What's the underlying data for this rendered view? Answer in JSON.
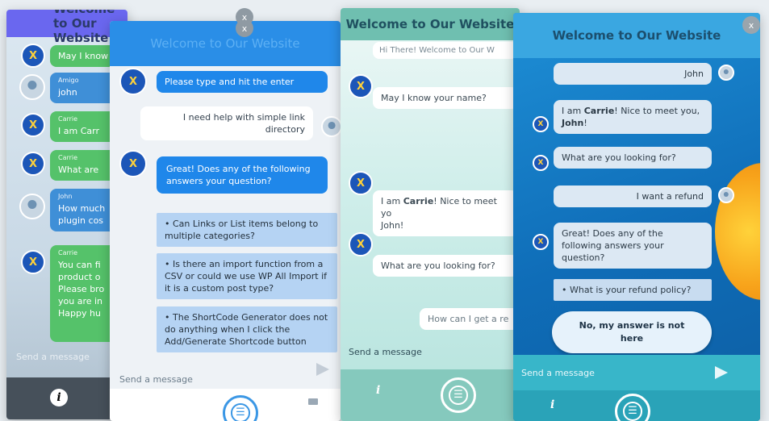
{
  "close_label": "x",
  "info_label": "i",
  "send_icon": "send-icon",
  "p1": {
    "title": "Welcome to Our Website",
    "messages": [
      {
        "who": "",
        "text": "May I know"
      },
      {
        "who": "Amigo",
        "text": "john"
      },
      {
        "who": "Carrie",
        "text": "I am Carr"
      },
      {
        "who": "Carrie",
        "text": "What are"
      },
      {
        "who": "John",
        "text": "How much plugin cos"
      },
      {
        "who": "Carrie",
        "text": "You can fi product o Please bro you are in Happy hu"
      }
    ],
    "input_placeholder": "Send a message"
  },
  "p2": {
    "title": "Welcome to Our Website",
    "bot1": "Please type and hit the enter",
    "user1": "I need help with simple link directory",
    "bot2": "Great! Does any of the following answers your question?",
    "options": [
      "Can Links or List items belong to multiple categories?",
      "Is there an import function from a CSV or could we use WP All Import if it is a custom post type?",
      "The ShortCode Generator does not do anything when I click the Add/Generate Shortcode button"
    ],
    "input_placeholder": "Send a message"
  },
  "p3": {
    "title": "Welcome to Our Website",
    "msg0": "Hi There! Welcome to Our W",
    "msg1": "May I know your name?",
    "msg2_pre": "I am ",
    "msg2_name": "Carrie",
    "msg2_post": "! Nice to meet yo",
    "msg2_name2": "John",
    "msg2_end": "!",
    "msg3": "What are you looking for?",
    "user1": "How can I get a re",
    "input_placeholder": "Send a message"
  },
  "p4": {
    "title": "Welcome to Our Website",
    "user_john": "John",
    "bot1_pre": "I am ",
    "bot1_name": "Carrie",
    "bot1_mid": "! Nice to meet you, ",
    "bot1_name2": "John",
    "bot1_end": "!",
    "bot2": "What are you looking for?",
    "user2": "I want a refund",
    "bot3": "Great! Does any of the following answers your question?",
    "option1": "What is your refund policy?",
    "no_button": "No, my answer is not here",
    "input_placeholder": "Send a message"
  }
}
